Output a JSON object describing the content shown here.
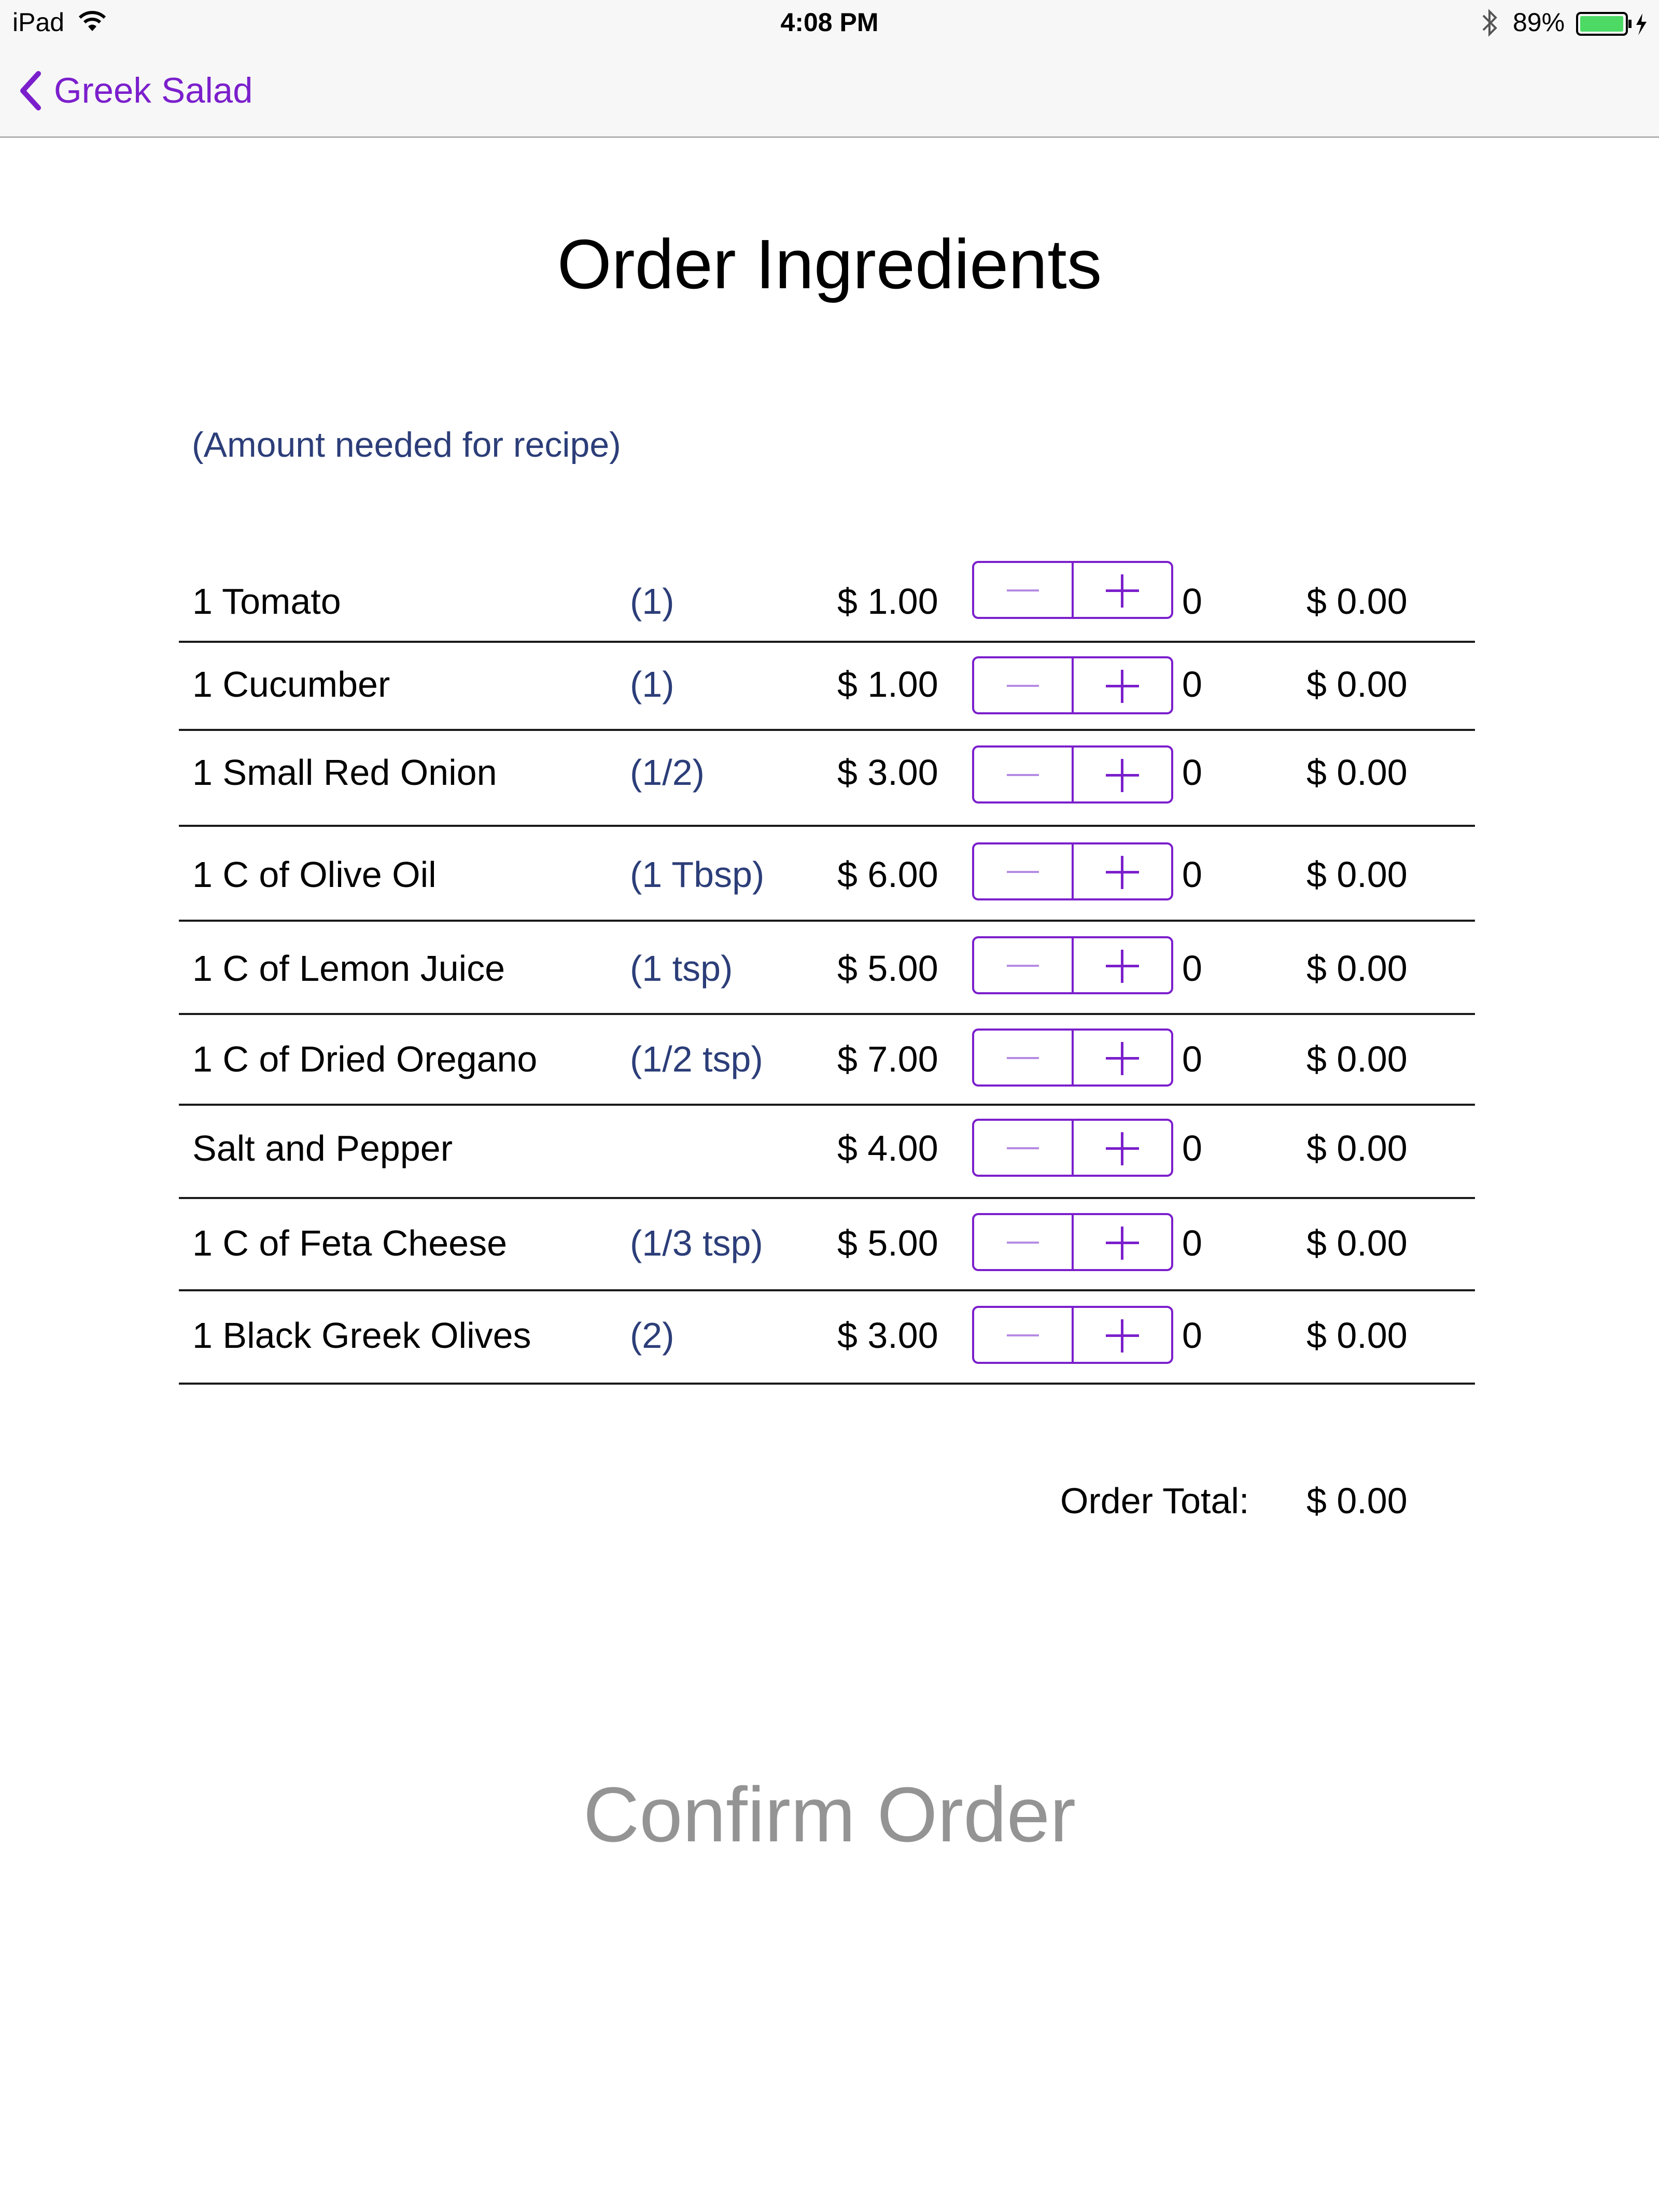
{
  "status_bar": {
    "device": "iPad",
    "time": "4:08 PM",
    "battery_percent": "89%",
    "icons": [
      "wifi-icon",
      "bluetooth-icon",
      "battery-charging-icon"
    ]
  },
  "nav": {
    "back_label": "Greek Salad",
    "accent_color": "#7b1fcc"
  },
  "title": "Order Ingredients",
  "amount_note": "(Amount needed for recipe)",
  "ingredients": [
    {
      "name": "1 Tomato",
      "amount": "(1)",
      "price": "$ 1.00",
      "quantity": "0",
      "line_total": "$ 0.00"
    },
    {
      "name": "1 Cucumber",
      "amount": "(1)",
      "price": "$ 1.00",
      "quantity": "0",
      "line_total": "$ 0.00"
    },
    {
      "name": "1 Small Red Onion",
      "amount": "(1/2)",
      "price": "$ 3.00",
      "quantity": "0",
      "line_total": "$ 0.00"
    },
    {
      "name": "1 C of Olive Oil",
      "amount": "(1 Tbsp)",
      "price": "$ 6.00",
      "quantity": "0",
      "line_total": "$ 0.00"
    },
    {
      "name": "1 C of Lemon Juice",
      "amount": "(1 tsp)",
      "price": "$ 5.00",
      "quantity": "0",
      "line_total": "$ 0.00"
    },
    {
      "name": "1 C of Dried Oregano",
      "amount": "(1/2 tsp)",
      "price": "$ 7.00",
      "quantity": "0",
      "line_total": "$ 0.00"
    },
    {
      "name": "Salt and Pepper",
      "amount": "",
      "price": "$ 4.00",
      "quantity": "0",
      "line_total": "$ 0.00"
    },
    {
      "name": "1 C of Feta Cheese",
      "amount": "(1/3 tsp)",
      "price": "$ 5.00",
      "quantity": "0",
      "line_total": "$ 0.00"
    },
    {
      "name": "1 Black Greek Olives",
      "amount": "(2)",
      "price": "$ 3.00",
      "quantity": "0",
      "line_total": "$ 0.00"
    }
  ],
  "order_total": {
    "label": "Order Total:",
    "value": "$ 0.00"
  },
  "confirm_label": "Confirm Order"
}
